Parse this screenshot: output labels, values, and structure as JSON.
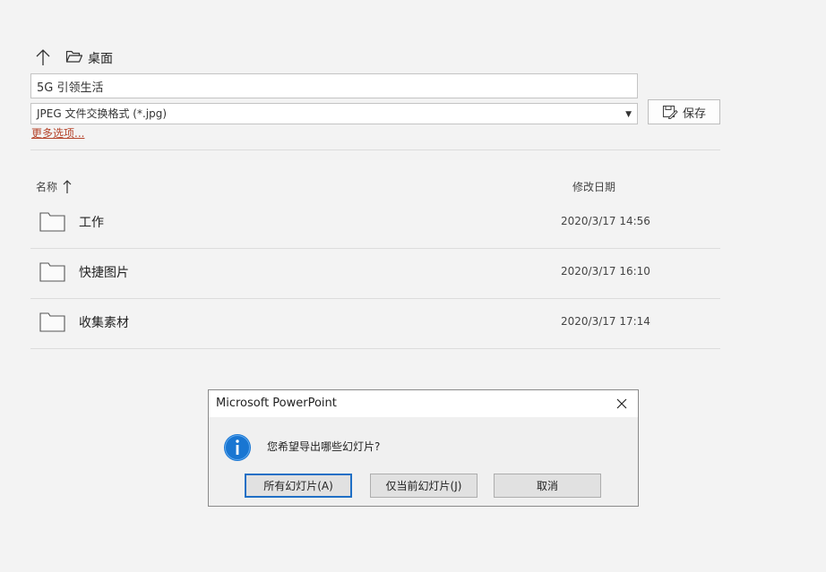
{
  "save_dialog": {
    "path": {
      "label": "桌面",
      "up_icon": "arrow-up-icon",
      "folder_icon": "folder-open-icon"
    },
    "filename": {
      "value": "5G 引领生活"
    },
    "filetype": {
      "value": "JPEG 文件交换格式 (*.jpg)"
    },
    "save_button": {
      "label": "保存",
      "icon": "save-icon"
    },
    "more_options": "更多选项...",
    "columns": {
      "name": "名称",
      "date": "修改日期"
    },
    "rows": [
      {
        "name": "工作",
        "date": "2020/3/17 14:56"
      },
      {
        "name": "快捷图片",
        "date": "2020/3/17 16:10"
      },
      {
        "name": "收集素材",
        "date": "2020/3/17 17:14"
      }
    ]
  },
  "message_box": {
    "title": "Microsoft PowerPoint",
    "message": "您希望导出哪些幻灯片?",
    "icon": "info-icon",
    "buttons": {
      "all": "所有幻灯片(A)",
      "current": "仅当前幻灯片(J)",
      "cancel": "取消"
    }
  },
  "colors": {
    "accent": "#1f6fc5",
    "link": "#b5432a",
    "info_icon": "#1976d2"
  }
}
